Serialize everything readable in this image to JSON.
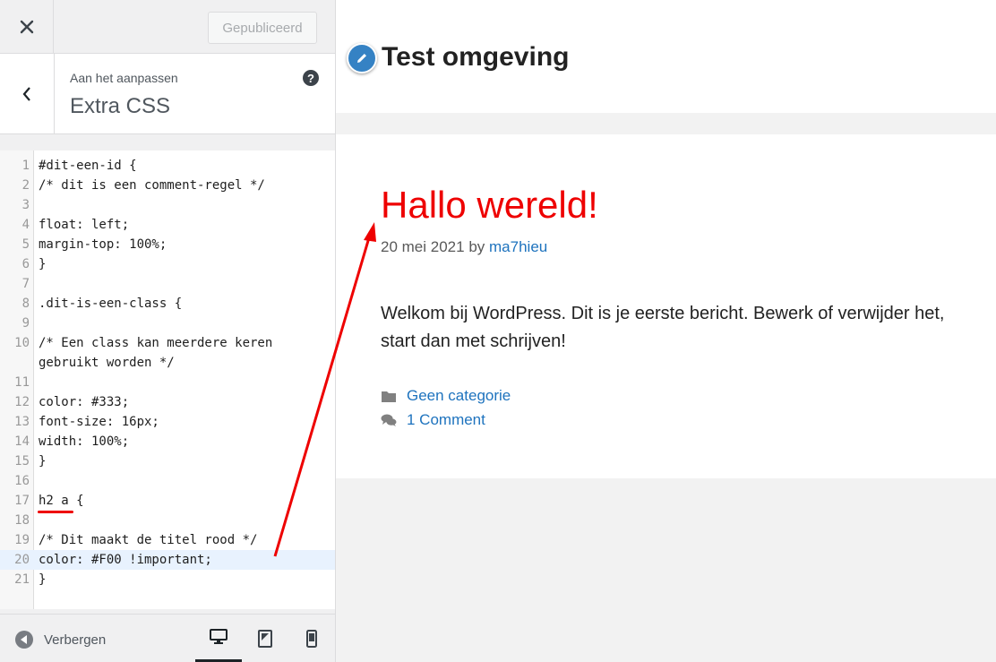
{
  "topbar": {
    "close_label": "×",
    "publish_label": "Gepubliceerd"
  },
  "section": {
    "crumb": "Aan het aanpassen",
    "title": "Extra CSS",
    "help": "?"
  },
  "editor": {
    "lines": [
      {
        "n": "1",
        "code": "#dit-een-id {"
      },
      {
        "n": "2",
        "code": "/* dit is een comment-regel */"
      },
      {
        "n": "3",
        "code": ""
      },
      {
        "n": "4",
        "code": "float: left;"
      },
      {
        "n": "5",
        "code": "margin-top: 100%;"
      },
      {
        "n": "6",
        "code": "}"
      },
      {
        "n": "7",
        "code": ""
      },
      {
        "n": "8",
        "code": ".dit-is-een-class {"
      },
      {
        "n": "9",
        "code": ""
      },
      {
        "n": "10",
        "code": "/* Een class kan meerdere keren"
      },
      {
        "n": "",
        "code": "gebruikt worden */"
      },
      {
        "n": "11",
        "code": ""
      },
      {
        "n": "12",
        "code": "color: #333;"
      },
      {
        "n": "13",
        "code": "font-size: 16px;"
      },
      {
        "n": "14",
        "code": "width: 100%;"
      },
      {
        "n": "15",
        "code": "}"
      },
      {
        "n": "16",
        "code": ""
      },
      {
        "n": "17",
        "code": "h2 a {"
      },
      {
        "n": "18",
        "code": ""
      },
      {
        "n": "19",
        "code": "/* Dit maakt de titel rood */"
      },
      {
        "n": "20",
        "code": "color: #F00 !important;"
      },
      {
        "n": "21",
        "code": "}"
      }
    ]
  },
  "footer": {
    "hide_label": "Verbergen"
  },
  "preview": {
    "site_title": "Test omgeving",
    "post_title": "Hallo wereld!",
    "post_date": "20 mei 2021",
    "post_by": "by",
    "post_author": "ma7hieu",
    "post_body": "Welkom bij WordPress. Dit is je eerste bericht. Bewerk of verwijder het, start dan met schrijven!",
    "category": "Geen categorie",
    "comments": "1 Comment"
  },
  "colors": {
    "accent": "#3582c4",
    "title_red": "#ee0000",
    "link": "#1e73be"
  }
}
